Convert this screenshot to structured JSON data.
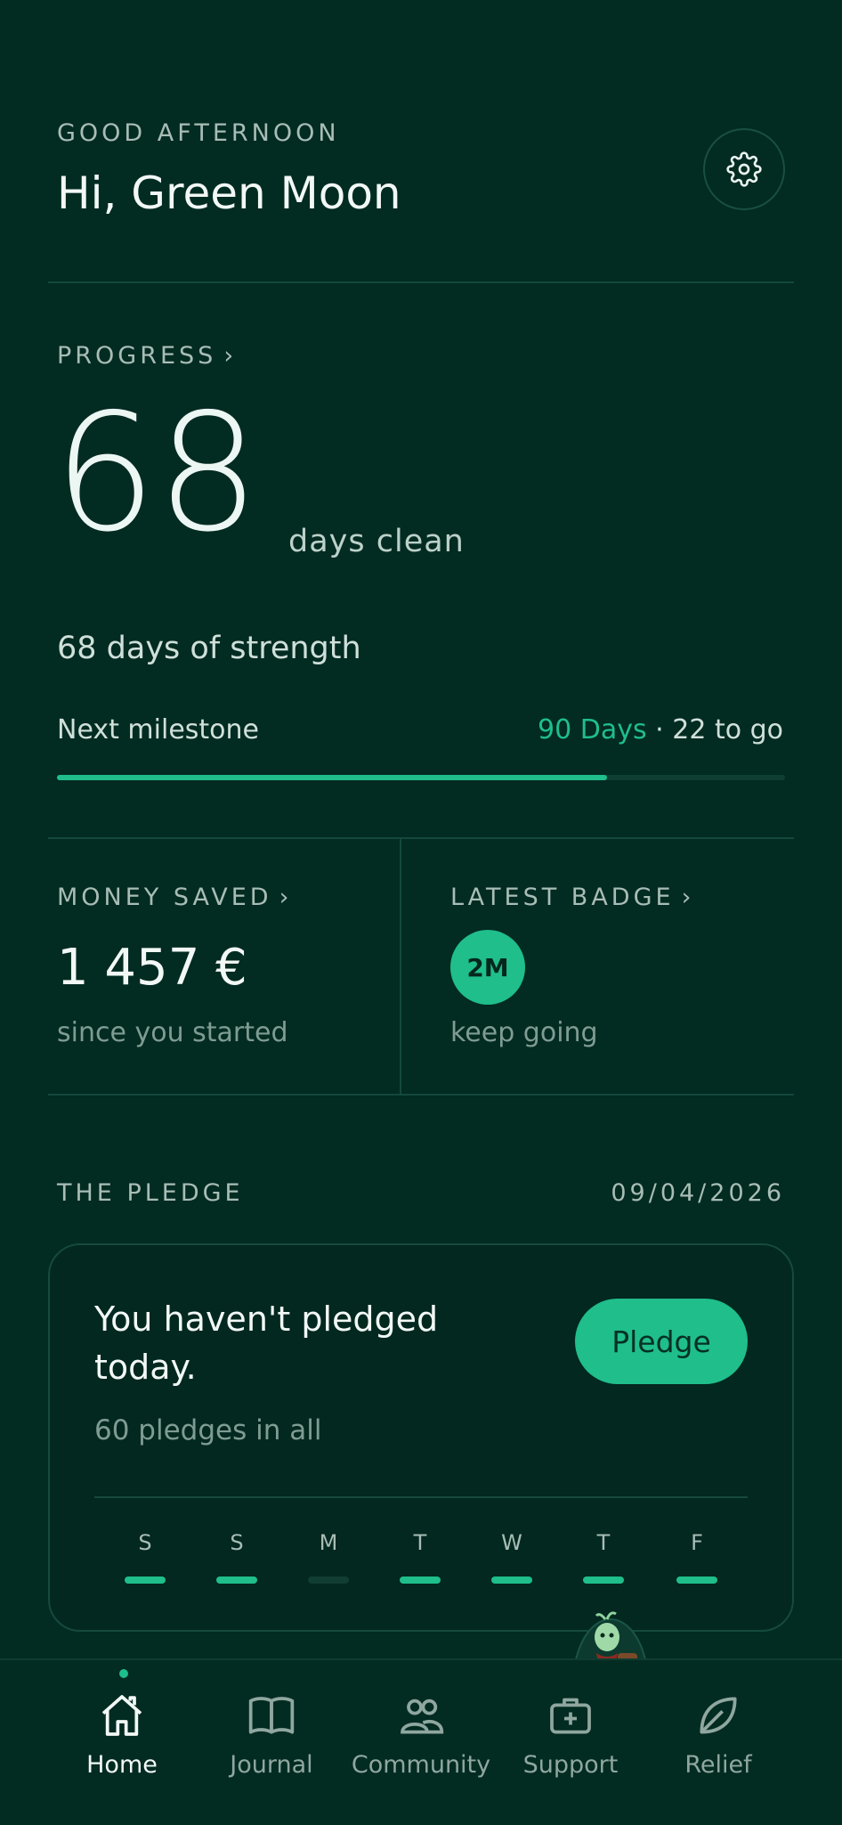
{
  "header": {
    "greeting": "GOOD AFTERNOON",
    "name": "Hi, Green Moon",
    "settings_icon": "gear-icon"
  },
  "progress": {
    "label": "PROGRESS",
    "days": "68",
    "days_text": "days clean",
    "subtitle": "68 days of strength",
    "milestone_label": "Next milestone",
    "milestone_target": "90 Days",
    "milestone_separator": " · ",
    "milestone_remaining": "22 to go",
    "progress_fraction": 0.7556
  },
  "money": {
    "label": "MONEY SAVED",
    "value": "1 457 €",
    "sub": "since you started"
  },
  "badge": {
    "label": "LATEST BADGE",
    "code": "2M",
    "sub": "keep going"
  },
  "pledge": {
    "label": "THE PLEDGE",
    "date": "09/04/2026",
    "title": "You haven't pledged today.",
    "count": "60 pledges in all",
    "button": "Pledge",
    "days": [
      {
        "letter": "S",
        "done": true
      },
      {
        "letter": "S",
        "done": true
      },
      {
        "letter": "M",
        "done": false
      },
      {
        "letter": "T",
        "done": true
      },
      {
        "letter": "W",
        "done": true
      },
      {
        "letter": "T",
        "done": true
      },
      {
        "letter": "F",
        "done": true
      }
    ]
  },
  "nav": {
    "items": [
      {
        "label": "Home",
        "icon": "home-icon",
        "active": true
      },
      {
        "label": "Journal",
        "icon": "book-icon",
        "active": false
      },
      {
        "label": "Community",
        "icon": "people-icon",
        "active": false
      },
      {
        "label": "Support",
        "icon": "first-aid-icon",
        "active": false
      },
      {
        "label": "Relief",
        "icon": "leaf-icon",
        "active": false
      }
    ]
  },
  "colors": {
    "background": "#022b22",
    "accent": "#1fbe8a",
    "muted": "#7f9c92"
  }
}
